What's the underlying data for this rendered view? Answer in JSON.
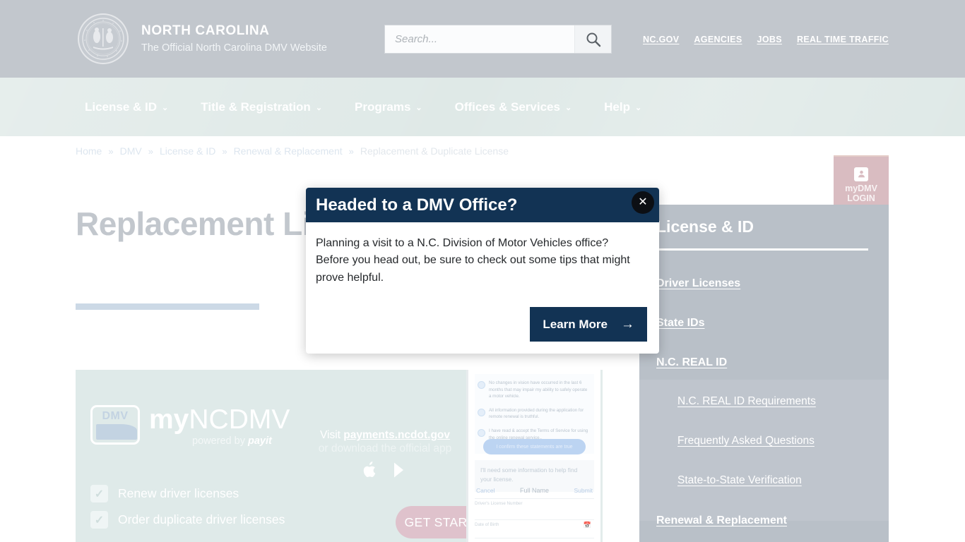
{
  "header": {
    "brand_title": "NORTH CAROLINA",
    "brand_subtitle": "The Official North Carolina DMV Website",
    "seal_alt": "nc-state-seal",
    "search_placeholder": "Search...",
    "search_value": "",
    "top_links": [
      "NC.GOV",
      "AGENCIES",
      "JOBS",
      "REAL TIME TRAFFIC"
    ]
  },
  "nav": {
    "items": [
      "License & ID",
      "Title & Registration",
      "Programs",
      "Offices & Services",
      "Help"
    ],
    "caret": "⌄",
    "mydmv_line1": "myDMV",
    "mydmv_line2": "LOGIN"
  },
  "breadcrumb": {
    "separator": "»",
    "items": [
      "Home",
      "DMV",
      "License & ID",
      "Renewal & Replacement"
    ],
    "current": "Replacement & Duplicate License"
  },
  "page": {
    "title": "Replacement License"
  },
  "banner": {
    "logo_text": "DMV",
    "wordmark_bold": "my",
    "wordmark_light": "NCDMV",
    "powered_prefix": "powered by ",
    "powered_brand": "payit",
    "checkmark": "✓",
    "features": [
      "Renew driver licenses",
      "Order duplicate driver licenses"
    ],
    "visit_prefix": "Visit ",
    "visit_url": "payments.ncdot.gov",
    "visit_line2": "or download the official app",
    "store_icons": [
      "apple-app-store-icon",
      "google-play-icon"
    ],
    "cta": "GET STARTED",
    "phone": {
      "statements": [
        "No changes in vision have occurred in the last 6 months that may impair my ability to safely operate a motor vehicle.",
        "All information provided during the application for remote renewal is truthful.",
        "I have read & accept the Terms of Service for using the online renewal service.."
      ],
      "confirm_button": "I confirm these statements are true",
      "need_info": "I'll need some information to help find your license.",
      "cancel": "Cancel",
      "form_title": "Full Name",
      "submit": "Submit",
      "field_license": "Driver's License Number",
      "field_dob": "Date of Birth",
      "calendar_icon": "calendar-icon"
    }
  },
  "sidebar": {
    "title": "License & ID",
    "links": [
      "Driver Licenses",
      "State IDs",
      "N.C. REAL ID"
    ],
    "sublinks": [
      "N.C. REAL ID Requirements",
      "Frequently Asked Questions",
      "State-to-State Verification"
    ],
    "last_link": "Renewal & Replacement"
  },
  "modal": {
    "title": "Headed to a DMV Office?",
    "close_label": "✕",
    "body": "Planning a visit to a N.C. Division of Motor Vehicles office? Before you head out, be sure to check out some tips that might prove helpful.",
    "cta_label": "Learn More",
    "cta_arrow": "→"
  },
  "colors": {
    "header_bg": "#c2c7cd",
    "nav_bg": "#dfe9e7",
    "mydmv_bg": "#d9bcc1",
    "modal_header": "#123354",
    "sidebar_bg": "#b9c0c8",
    "title_rule": "#ccd9e6",
    "banner_bg": "#dfeae9"
  }
}
